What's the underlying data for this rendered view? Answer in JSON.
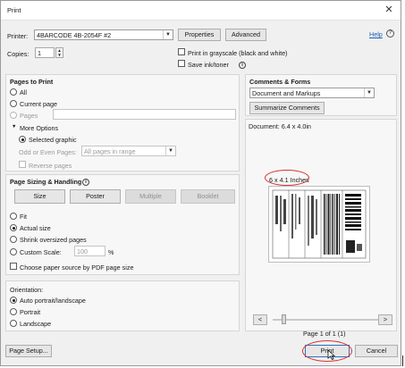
{
  "window": {
    "title": "Print",
    "close": "✕"
  },
  "header": {
    "printer_label": "Printer:",
    "printer_value": "4BARCODE 4B-2054F #2",
    "properties": "Properties",
    "advanced": "Advanced",
    "help": "Help",
    "help_icon": "?",
    "copies_label": "Copies:",
    "copies_value": "1",
    "grayscale": "Print in grayscale (black and white)",
    "save_ink": "Save ink/toner",
    "info_icon": "i"
  },
  "pages": {
    "title": "Pages to Print",
    "all": "All",
    "current": "Current page",
    "pages": "Pages",
    "more_options": "More Options",
    "selected_graphic": "Selected graphic",
    "odd_even_label": "Odd or Even Pages:",
    "odd_even_value": "All pages in range",
    "reverse": "Reverse pages"
  },
  "sizing": {
    "title": "Page Sizing & Handling",
    "info_icon": "i",
    "size": "Size",
    "poster": "Poster",
    "multiple": "Multiple",
    "booklet": "Booklet",
    "fit": "Fit",
    "actual": "Actual size",
    "shrink": "Shrink oversized pages",
    "custom": "Custom Scale:",
    "custom_value": "100",
    "percent": "%",
    "choose_source": "Choose paper source by PDF page size"
  },
  "orientation": {
    "title": "Orientation:",
    "auto": "Auto portrait/landscape",
    "portrait": "Portrait",
    "landscape": "Landscape"
  },
  "comments": {
    "title": "Comments & Forms",
    "value": "Document and Markups",
    "summarize": "Summarize Comments"
  },
  "preview": {
    "document": "Document: 6.4 x 4.0in",
    "size_label": "6 x 4.1 Inches",
    "page_info": "Page 1 of 1 (1)",
    "prev": "<",
    "next": ">"
  },
  "footer": {
    "page_setup": "Page Setup...",
    "print": "Print",
    "cancel": "Cancel"
  },
  "colors": {
    "annotation": "#d73535",
    "panel": "#f7f7f7",
    "window": "#f0f0f0"
  }
}
